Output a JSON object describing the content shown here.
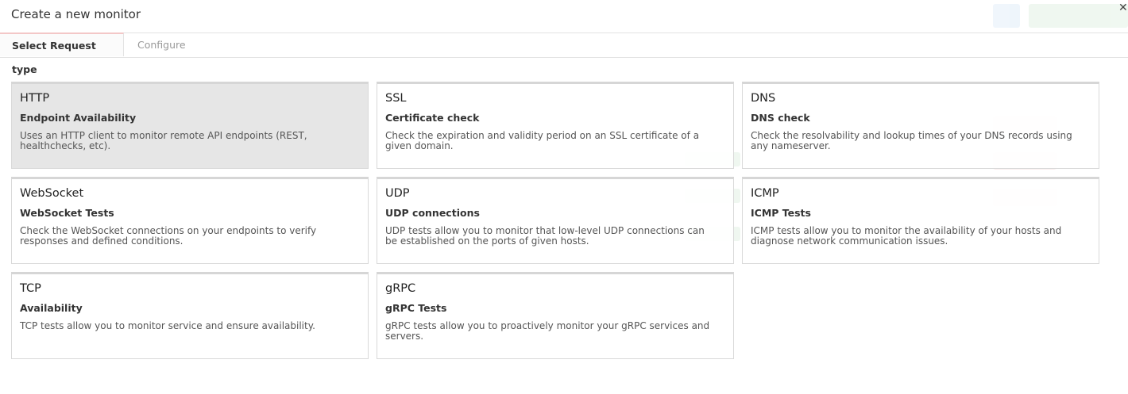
{
  "modal": {
    "title": "Create a new monitor",
    "close_icon": "close-icon"
  },
  "tabs": [
    {
      "label": "Select Request type",
      "active": true
    },
    {
      "label": "Configure",
      "active": false
    }
  ],
  "cards": [
    {
      "name": "HTTP",
      "subtitle": "Endpoint Availability",
      "description": "Uses an HTTP client to monitor remote API endpoints (REST, healthchecks, etc).",
      "selected": true
    },
    {
      "name": "SSL",
      "subtitle": "Certificate check",
      "description": "Check the expiration and validity period on an SSL certificate of a given domain.",
      "selected": false
    },
    {
      "name": "DNS",
      "subtitle": "DNS check",
      "description": "Check the resolvability and lookup times of your DNS records using any nameserver.",
      "selected": false
    },
    {
      "name": "WebSocket",
      "subtitle": "WebSocket Tests",
      "description": "Check the WebSocket connections on your endpoints to verify responses and defined conditions.",
      "selected": false
    },
    {
      "name": "UDP",
      "subtitle": "UDP connections",
      "description": "UDP tests allow you to monitor that low-level UDP connections can be established on the ports of given hosts.",
      "selected": false
    },
    {
      "name": "ICMP",
      "subtitle": "ICMP Tests",
      "description": "ICMP tests allow you to monitor the availability of your hosts and diagnose network communication issues.",
      "selected": false
    },
    {
      "name": "TCP",
      "subtitle": "Availability",
      "description": "TCP tests allow you to monitor service and ensure availability.",
      "selected": false
    },
    {
      "name": "gRPC",
      "subtitle": "gRPC Tests",
      "description": "gRPC tests allow you to proactively monitor your gRPC services and servers.",
      "selected": false
    }
  ]
}
